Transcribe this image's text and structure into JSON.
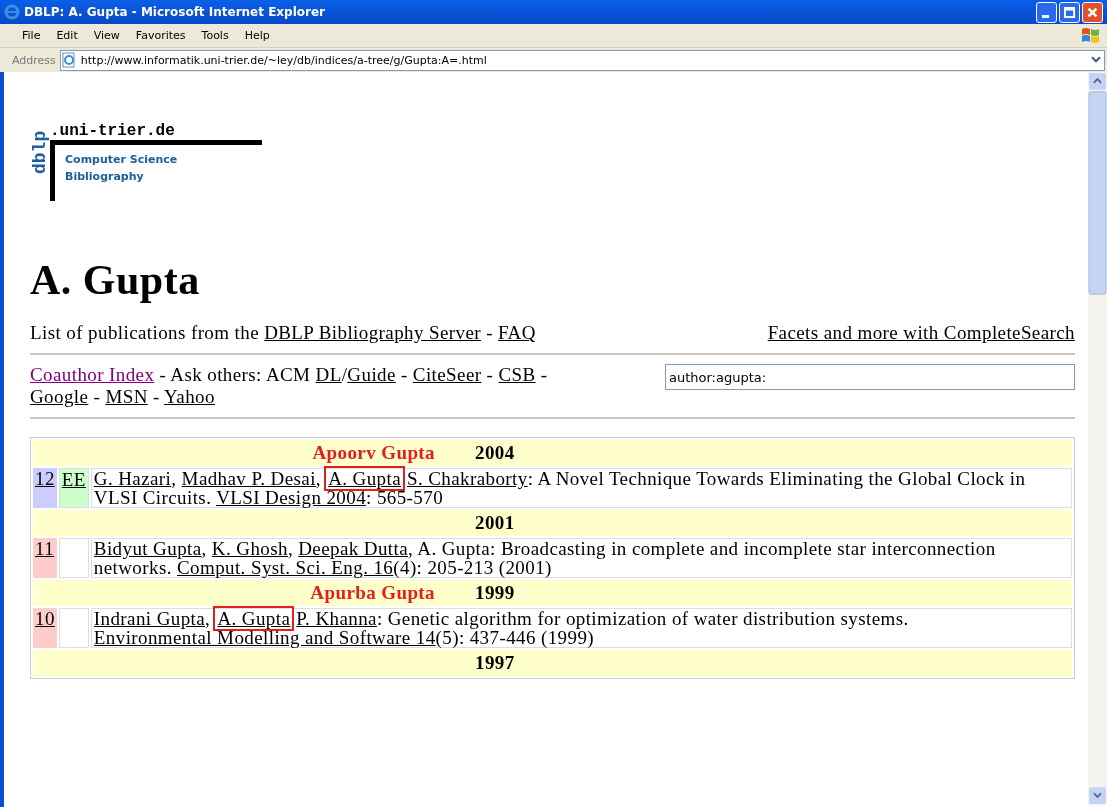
{
  "window": {
    "title": "DBLP: A. Gupta - Microsoft Internet Explorer"
  },
  "menu": [
    "File",
    "Edit",
    "View",
    "Favorites",
    "Tools",
    "Help"
  ],
  "address_bar": {
    "label": "Address",
    "value": "http://www.informatik.uni-trier.de/~ley/db/indices/a-tree/g/Gupta:A=.html"
  },
  "logo": {
    "vertical": "dblp",
    "domain": ".uni-trier.de",
    "subtitle": [
      "Computer Science",
      "Bibliography"
    ]
  },
  "heading": "A. Gupta",
  "intro": [
    {
      "kind": "text",
      "text": "List of publications from the "
    },
    {
      "kind": "link",
      "text": "DBLP Bibliography Server"
    },
    {
      "kind": "text",
      "text": " - "
    },
    {
      "kind": "link",
      "text": "FAQ"
    }
  ],
  "complete_search_link": "Facets and more with CompleteSearch",
  "others": [
    {
      "kind": "visited_link",
      "text": "Coauthor Index"
    },
    {
      "kind": "text",
      "text": " - Ask others: ACM "
    },
    {
      "kind": "link",
      "text": "DL"
    },
    {
      "kind": "text",
      "text": "/"
    },
    {
      "kind": "link",
      "text": "Guide"
    },
    {
      "kind": "text",
      "text": " - "
    },
    {
      "kind": "link",
      "text": "CiteSeer"
    },
    {
      "kind": "text",
      "text": " - "
    },
    {
      "kind": "link",
      "text": "CSB"
    },
    {
      "kind": "text",
      "text": " - "
    },
    {
      "kind": "link",
      "text": "Google"
    },
    {
      "kind": "text",
      "text": " - "
    },
    {
      "kind": "link",
      "text": "MSN"
    },
    {
      "kind": "text",
      "text": " - "
    },
    {
      "kind": "link",
      "text": "Yahoo"
    }
  ],
  "search": {
    "value": "author:agupta:"
  },
  "publications": [
    {
      "kind": "year",
      "year": "2004",
      "annotation": "Apoorv Gupta"
    },
    {
      "kind": "entry",
      "number": "12",
      "color": "#ccccff",
      "ee": "EE",
      "citation": [
        {
          "kind": "link",
          "text": "G. Hazari"
        },
        {
          "kind": "text",
          "text": ", "
        },
        {
          "kind": "link",
          "text": "Madhav P. Desai"
        },
        {
          "kind": "text",
          "text": ", "
        },
        {
          "kind": "boxed_link",
          "text": "A. Gupta"
        },
        {
          "kind": "link",
          "text": "S. Chakraborty"
        },
        {
          "kind": "text",
          "text": ": A Novel Technique Towards Eliminating the Global Clock in VLSI Circuits. "
        },
        {
          "kind": "link",
          "text": "VLSI Design 2004"
        },
        {
          "kind": "text",
          "text": ": 565-570"
        }
      ]
    },
    {
      "kind": "year",
      "year": "2001"
    },
    {
      "kind": "entry",
      "number": "11",
      "color": "#ffcccc",
      "citation": [
        {
          "kind": "link",
          "text": "Bidyut Gupta"
        },
        {
          "kind": "text",
          "text": ", "
        },
        {
          "kind": "link",
          "text": "K. Ghosh"
        },
        {
          "kind": "text",
          "text": ", "
        },
        {
          "kind": "link",
          "text": "Deepak Dutta"
        },
        {
          "kind": "text",
          "text": ", A. Gupta: Broadcasting in complete and incomplete star interconnection networks. "
        },
        {
          "kind": "link",
          "text": "Comput. Syst. Sci. Eng. 16"
        },
        {
          "kind": "text",
          "text": "(4): 205-213 (2001)"
        }
      ]
    },
    {
      "kind": "year",
      "year": "1999",
      "annotation": "Apurba Gupta"
    },
    {
      "kind": "entry",
      "number": "10",
      "color": "#ffcccc",
      "citation": [
        {
          "kind": "link",
          "text": "Indrani Gupta"
        },
        {
          "kind": "text",
          "text": ", "
        },
        {
          "kind": "boxed_link",
          "text": "A. Gupta"
        },
        {
          "kind": "link",
          "text": "P. Khanna"
        },
        {
          "kind": "text",
          "text": ": Genetic algorithm for optimization of water distribution systems. "
        },
        {
          "kind": "link",
          "text": "Environmental Modelling and Software 14"
        },
        {
          "kind": "text",
          "text": "(5): 437-446 (1999)"
        }
      ]
    },
    {
      "kind": "year",
      "year": "1997"
    }
  ]
}
